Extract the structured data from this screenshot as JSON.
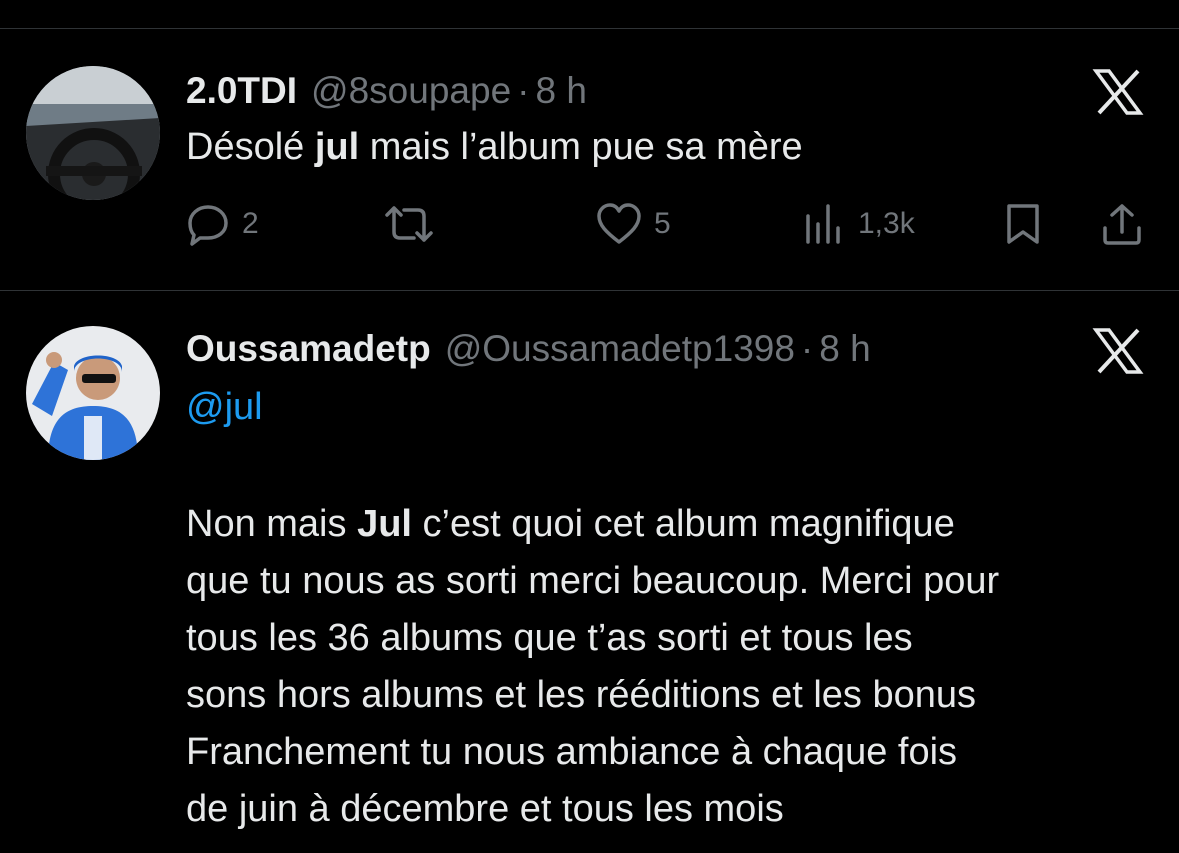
{
  "tweets": [
    {
      "name": "2.0TDI",
      "handle": "@8soupape",
      "separator": "·",
      "time": "8 h",
      "text_pre": "Désolé ",
      "text_bold": "jul",
      "text_post": " mais l’album pue sa mère",
      "avatar_icon": "car-steering-wheel-photo",
      "actions": {
        "replies": "2",
        "likes": "5",
        "views": "1,3k"
      }
    },
    {
      "name": "Oussamadetp",
      "handle": "@Oussamadetp1398",
      "separator": "·",
      "time": "8 h",
      "mention": "@jul",
      "avatar_icon": "person-blue-outfit-photo",
      "lines": [
        {
          "pre": "Non mais ",
          "bold": "Jul",
          "post": " c’est quoi cet album magnifique"
        },
        {
          "pre": "que tu nous as sorti merci beaucoup. Merci pour"
        },
        {
          "pre": "tous les 36 albums que t’as sorti et tous les"
        },
        {
          "pre": "sons hors albums et les rééditions et les bonus"
        },
        {
          "pre": "Franchement tu nous ambiance à chaque fois"
        },
        {
          "pre": "de juin à décembre et tous les mois"
        }
      ]
    }
  ],
  "colors": {
    "background": "#000000",
    "text": "#e7e9ea",
    "secondary": "#71767b",
    "link": "#1d9bf0",
    "divider": "#2f3336"
  }
}
